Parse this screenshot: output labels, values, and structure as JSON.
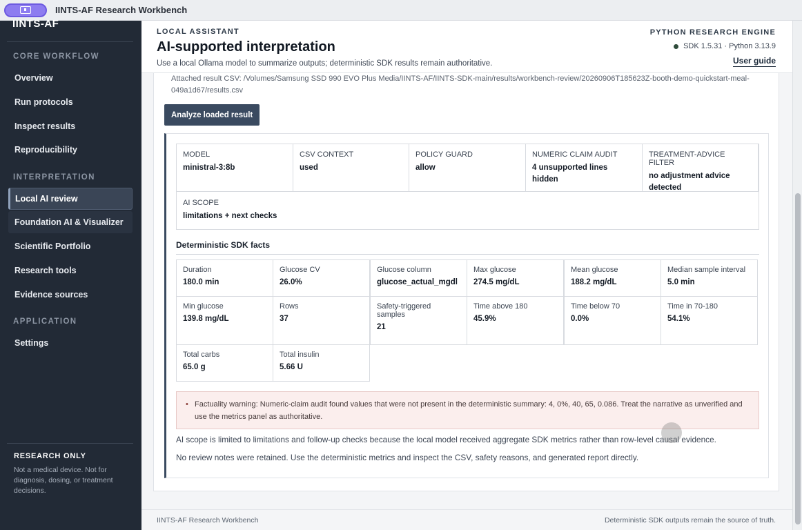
{
  "window": {
    "title": "IINTS-AF Research Workbench"
  },
  "sidebar": {
    "brand": "IINTS-AF",
    "sections": [
      {
        "label": "CORE WORKFLOW"
      },
      {
        "label": "INTERPRETATION"
      },
      {
        "label": "APPLICATION"
      }
    ],
    "items": [
      {
        "label": "Overview"
      },
      {
        "label": "Run protocols"
      },
      {
        "label": "Inspect results"
      },
      {
        "label": "Reproducibility"
      },
      {
        "label": "Local AI review"
      },
      {
        "label": "Foundation AI & Visualizer"
      },
      {
        "label": "Scientific Portfolio"
      },
      {
        "label": "Research tools"
      },
      {
        "label": "Evidence sources"
      },
      {
        "label": "Settings"
      }
    ],
    "notice": {
      "title": "RESEARCH ONLY",
      "text": "Not a medical device. Not for diagnosis, dosing, or treatment decisions."
    }
  },
  "header": {
    "eyebrow": "LOCAL ASSISTANT",
    "title": "AI-supported interpretation",
    "subtitle": "Use a local Ollama model to summarize outputs; deterministic SDK results remain authoritative.",
    "engine_label": "PYTHON RESEARCH ENGINE",
    "sdk_status": "SDK 1.5.31 · Python 3.13.9",
    "user_guide": "User guide"
  },
  "main": {
    "attached_csv": "Attached result CSV: /Volumes/Samsung SSD 990 EVO Plus Media/IINTS-AF/IINTS-SDK-main/results/workbench-review/20260906T185623Z-booth-demo-quickstart-meal-049a1d67/results.csv",
    "analyze_button": "Analyze loaded result",
    "meta": [
      {
        "label": "MODEL",
        "value": "ministral-3:8b"
      },
      {
        "label": "CSV CONTEXT",
        "value": "used"
      },
      {
        "label": "POLICY GUARD",
        "value": "allow"
      },
      {
        "label": "NUMERIC CLAIM AUDIT",
        "value": "4 unsupported lines hidden"
      },
      {
        "label": "TREATMENT-ADVICE FILTER",
        "value": "no adjustment advice detected"
      },
      {
        "label": "AI SCOPE",
        "value": "limitations + next checks"
      }
    ],
    "facts_title": "Deterministic SDK facts",
    "facts": [
      {
        "label": "Duration",
        "value": "180.0 min"
      },
      {
        "label": "Glucose CV",
        "value": "26.0%"
      },
      {
        "label": "Glucose column",
        "value": "glucose_actual_mgdl"
      },
      {
        "label": "Max glucose",
        "value": "274.5 mg/dL"
      },
      {
        "label": "Mean glucose",
        "value": "188.2 mg/dL"
      },
      {
        "label": "Median sample interval",
        "value": "5.0 min"
      },
      {
        "label": "Min glucose",
        "value": "139.8 mg/dL"
      },
      {
        "label": "Rows",
        "value": "37"
      },
      {
        "label": "Safety-triggered samples",
        "value": "21"
      },
      {
        "label": "Time above 180",
        "value": "45.9%"
      },
      {
        "label": "Time below 70",
        "value": "0.0%"
      },
      {
        "label": "Time in 70-180",
        "value": "54.1%"
      },
      {
        "label": "Total carbs",
        "value": "65.0 g"
      },
      {
        "label": "Total insulin",
        "value": "5.66 U"
      }
    ],
    "warning": "Factuality warning: Numeric-claim audit found values that were not present in the deterministic summary: 4, 0%, 40, 65, 0.086. Treat the narrative as unverified and use the metrics panel as authoritative.",
    "notes": [
      "AI scope is limited to limitations and follow-up checks because the local model received aggregate SDK metrics rather than row-level causal evidence.",
      "No review notes were retained. Use the deterministic metrics and inspect the CSV, safety reasons, and generated report directly."
    ]
  },
  "footer": {
    "left": "IINTS-AF Research Workbench",
    "right": "Deterministic SDK outputs remain the source of truth."
  },
  "icons": {
    "app": "monitor-icon",
    "status": "status-dot-icon"
  },
  "colors": {
    "sidebar": "#222a36",
    "accent": "#3a4a60",
    "warning_bg": "#fbeeed",
    "app_pill": "#8d7cf0"
  }
}
